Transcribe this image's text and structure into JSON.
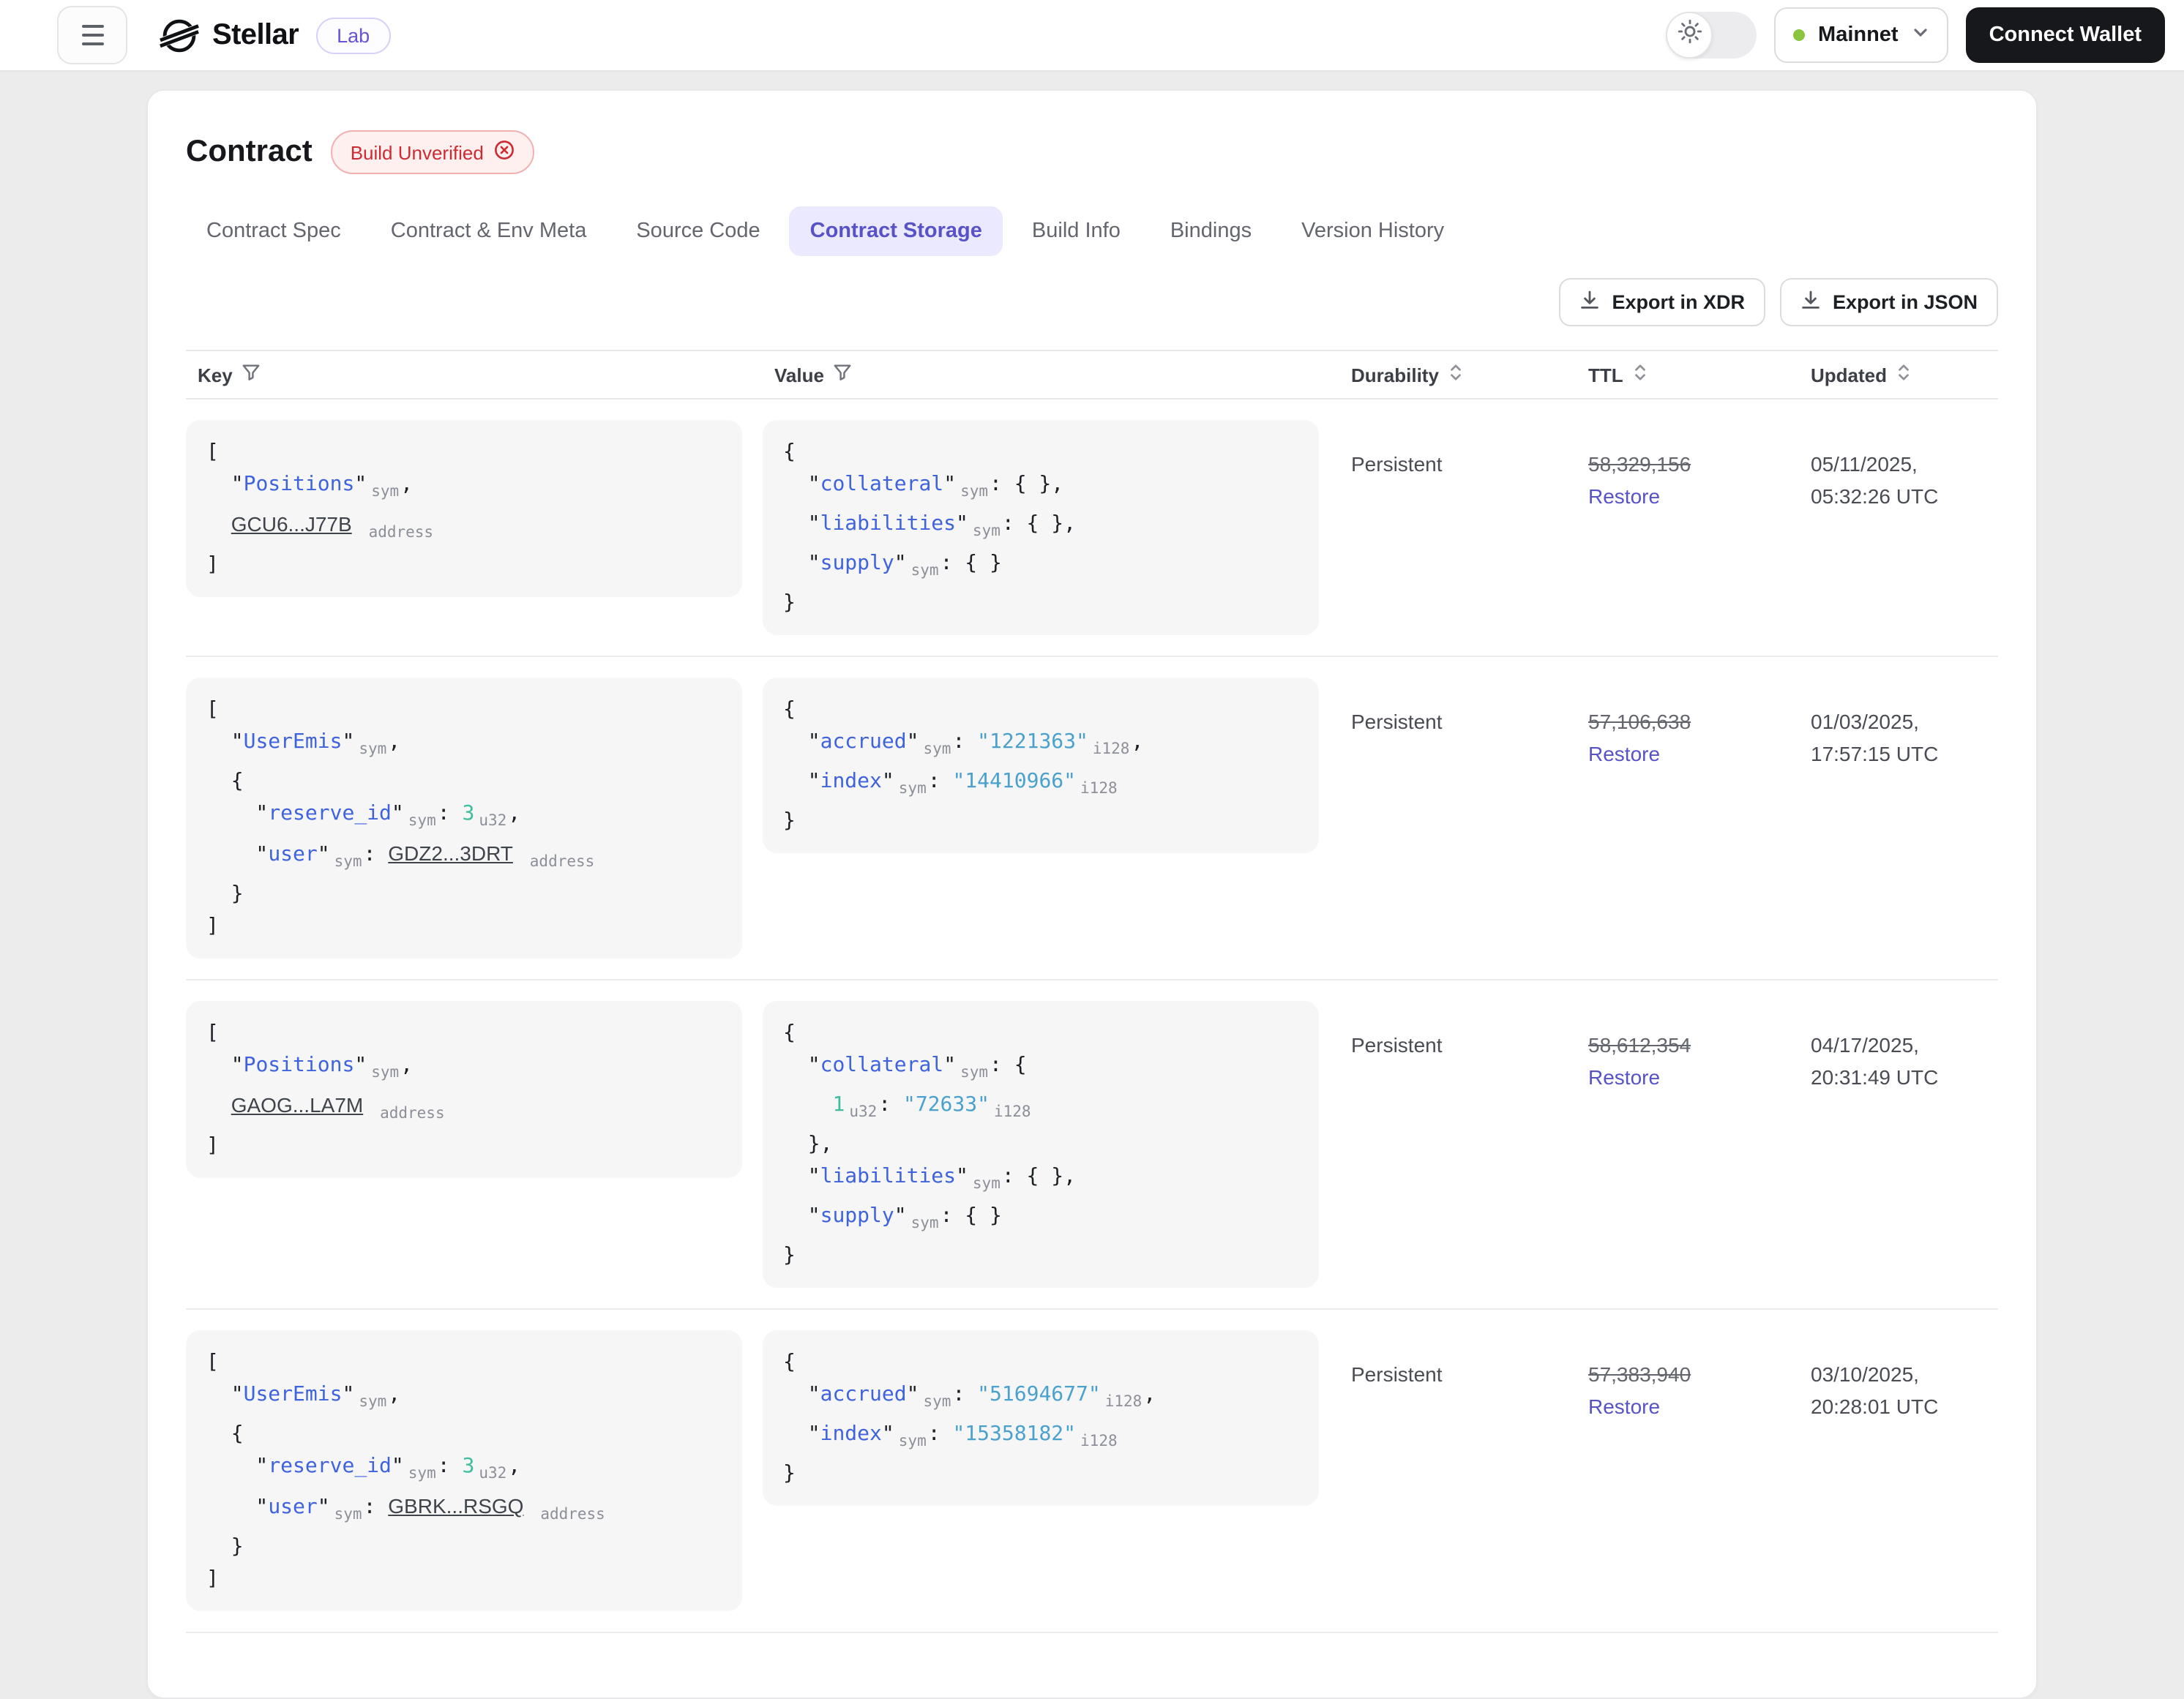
{
  "header": {
    "brand": "Stellar",
    "badge": "Lab",
    "network": "Mainnet",
    "connect_wallet": "Connect Wallet"
  },
  "page": {
    "title": "Contract",
    "status_badge": "Build Unverified",
    "tabs": [
      {
        "label": "Contract Spec"
      },
      {
        "label": "Contract & Env Meta"
      },
      {
        "label": "Source Code"
      },
      {
        "label": "Contract Storage",
        "active": true
      },
      {
        "label": "Build Info"
      },
      {
        "label": "Bindings"
      },
      {
        "label": "Version History"
      }
    ],
    "export_xdr": "Export in XDR",
    "export_json": "Export in JSON"
  },
  "table": {
    "columns": [
      "Key",
      "Value",
      "Durability",
      "TTL",
      "Updated"
    ],
    "rows": [
      {
        "key": [
          [
            {
              "t": "[",
              "c": "p"
            }
          ],
          [
            {
              "t": "  \"",
              "c": "p"
            },
            {
              "t": "Positions",
              "c": "k"
            },
            {
              "t": "\"",
              "c": "p"
            },
            {
              "t": "sym",
              "c": "l"
            },
            {
              "t": ",",
              "c": "p"
            }
          ],
          [
            {
              "t": "  ",
              "c": "p"
            },
            {
              "t": "GCU6...J77B",
              "c": "a"
            },
            {
              "t": " ",
              "c": "p"
            },
            {
              "t": "address",
              "c": "l"
            }
          ],
          [
            {
              "t": "]",
              "c": "p"
            }
          ]
        ],
        "value": [
          [
            {
              "t": "{",
              "c": "p"
            }
          ],
          [
            {
              "t": "  \"",
              "c": "p"
            },
            {
              "t": "collateral",
              "c": "k"
            },
            {
              "t": "\"",
              "c": "p"
            },
            {
              "t": "sym",
              "c": "l"
            },
            {
              "t": ": { },",
              "c": "p"
            }
          ],
          [
            {
              "t": "  \"",
              "c": "p"
            },
            {
              "t": "liabilities",
              "c": "k"
            },
            {
              "t": "\"",
              "c": "p"
            },
            {
              "t": "sym",
              "c": "l"
            },
            {
              "t": ": { },",
              "c": "p"
            }
          ],
          [
            {
              "t": "  \"",
              "c": "p"
            },
            {
              "t": "supply",
              "c": "k"
            },
            {
              "t": "\"",
              "c": "p"
            },
            {
              "t": "sym",
              "c": "l"
            },
            {
              "t": ": { }",
              "c": "p"
            }
          ],
          [
            {
              "t": "}",
              "c": "p"
            }
          ]
        ],
        "durability": "Persistent",
        "ttl": "58,329,156",
        "restore": "Restore",
        "updated": [
          "05/11/2025,",
          "05:32:26 UTC"
        ]
      },
      {
        "key": [
          [
            {
              "t": "[",
              "c": "p"
            }
          ],
          [
            {
              "t": "  \"",
              "c": "p"
            },
            {
              "t": "UserEmis",
              "c": "k"
            },
            {
              "t": "\"",
              "c": "p"
            },
            {
              "t": "sym",
              "c": "l"
            },
            {
              "t": ",",
              "c": "p"
            }
          ],
          [
            {
              "t": "  {",
              "c": "p"
            }
          ],
          [
            {
              "t": "    \"",
              "c": "p"
            },
            {
              "t": "reserve_id",
              "c": "k"
            },
            {
              "t": "\"",
              "c": "p"
            },
            {
              "t": "sym",
              "c": "l"
            },
            {
              "t": ": ",
              "c": "p"
            },
            {
              "t": "3",
              "c": "g"
            },
            {
              "t": "u32",
              "c": "l"
            },
            {
              "t": ",",
              "c": "p"
            }
          ],
          [
            {
              "t": "    \"",
              "c": "p"
            },
            {
              "t": "user",
              "c": "k"
            },
            {
              "t": "\"",
              "c": "p"
            },
            {
              "t": "sym",
              "c": "l"
            },
            {
              "t": ": ",
              "c": "p"
            },
            {
              "t": "GDZ2...3DRT",
              "c": "a"
            },
            {
              "t": " ",
              "c": "p"
            },
            {
              "t": "address",
              "c": "l"
            }
          ],
          [
            {
              "t": "  }",
              "c": "p"
            }
          ],
          [
            {
              "t": "]",
              "c": "p"
            }
          ]
        ],
        "value": [
          [
            {
              "t": "{",
              "c": "p"
            }
          ],
          [
            {
              "t": "  \"",
              "c": "p"
            },
            {
              "t": "accrued",
              "c": "k"
            },
            {
              "t": "\"",
              "c": "p"
            },
            {
              "t": "sym",
              "c": "l"
            },
            {
              "t": ": ",
              "c": "p"
            },
            {
              "t": "\"1221363\"",
              "c": "n"
            },
            {
              "t": "i128",
              "c": "l"
            },
            {
              "t": ",",
              "c": "p"
            }
          ],
          [
            {
              "t": "  \"",
              "c": "p"
            },
            {
              "t": "index",
              "c": "k"
            },
            {
              "t": "\"",
              "c": "p"
            },
            {
              "t": "sym",
              "c": "l"
            },
            {
              "t": ": ",
              "c": "p"
            },
            {
              "t": "\"14410966\"",
              "c": "n"
            },
            {
              "t": "i128",
              "c": "l"
            }
          ],
          [
            {
              "t": "}",
              "c": "p"
            }
          ]
        ],
        "durability": "Persistent",
        "ttl": "57,106,638",
        "restore": "Restore",
        "updated": [
          "01/03/2025,",
          "17:57:15 UTC"
        ]
      },
      {
        "key": [
          [
            {
              "t": "[",
              "c": "p"
            }
          ],
          [
            {
              "t": "  \"",
              "c": "p"
            },
            {
              "t": "Positions",
              "c": "k"
            },
            {
              "t": "\"",
              "c": "p"
            },
            {
              "t": "sym",
              "c": "l"
            },
            {
              "t": ",",
              "c": "p"
            }
          ],
          [
            {
              "t": "  ",
              "c": "p"
            },
            {
              "t": "GAOG...LA7M",
              "c": "a"
            },
            {
              "t": " ",
              "c": "p"
            },
            {
              "t": "address",
              "c": "l"
            }
          ],
          [
            {
              "t": "]",
              "c": "p"
            }
          ]
        ],
        "value": [
          [
            {
              "t": "{",
              "c": "p"
            }
          ],
          [
            {
              "t": "  \"",
              "c": "p"
            },
            {
              "t": "collateral",
              "c": "k"
            },
            {
              "t": "\"",
              "c": "p"
            },
            {
              "t": "sym",
              "c": "l"
            },
            {
              "t": ": {",
              "c": "p"
            }
          ],
          [
            {
              "t": "    ",
              "c": "p"
            },
            {
              "t": "1",
              "c": "g"
            },
            {
              "t": "u32",
              "c": "l"
            },
            {
              "t": ": ",
              "c": "p"
            },
            {
              "t": "\"72633\"",
              "c": "n"
            },
            {
              "t": "i128",
              "c": "l"
            }
          ],
          [
            {
              "t": "  },",
              "c": "p"
            }
          ],
          [
            {
              "t": "  \"",
              "c": "p"
            },
            {
              "t": "liabilities",
              "c": "k"
            },
            {
              "t": "\"",
              "c": "p"
            },
            {
              "t": "sym",
              "c": "l"
            },
            {
              "t": ": { },",
              "c": "p"
            }
          ],
          [
            {
              "t": "  \"",
              "c": "p"
            },
            {
              "t": "supply",
              "c": "k"
            },
            {
              "t": "\"",
              "c": "p"
            },
            {
              "t": "sym",
              "c": "l"
            },
            {
              "t": ": { }",
              "c": "p"
            }
          ],
          [
            {
              "t": "}",
              "c": "p"
            }
          ]
        ],
        "durability": "Persistent",
        "ttl": "58,612,354",
        "restore": "Restore",
        "updated": [
          "04/17/2025,",
          "20:31:49 UTC"
        ]
      },
      {
        "key": [
          [
            {
              "t": "[",
              "c": "p"
            }
          ],
          [
            {
              "t": "  \"",
              "c": "p"
            },
            {
              "t": "UserEmis",
              "c": "k"
            },
            {
              "t": "\"",
              "c": "p"
            },
            {
              "t": "sym",
              "c": "l"
            },
            {
              "t": ",",
              "c": "p"
            }
          ],
          [
            {
              "t": "  {",
              "c": "p"
            }
          ],
          [
            {
              "t": "    \"",
              "c": "p"
            },
            {
              "t": "reserve_id",
              "c": "k"
            },
            {
              "t": "\"",
              "c": "p"
            },
            {
              "t": "sym",
              "c": "l"
            },
            {
              "t": ": ",
              "c": "p"
            },
            {
              "t": "3",
              "c": "g"
            },
            {
              "t": "u32",
              "c": "l"
            },
            {
              "t": ",",
              "c": "p"
            }
          ],
          [
            {
              "t": "    \"",
              "c": "p"
            },
            {
              "t": "user",
              "c": "k"
            },
            {
              "t": "\"",
              "c": "p"
            },
            {
              "t": "sym",
              "c": "l"
            },
            {
              "t": ": ",
              "c": "p"
            },
            {
              "t": "GBRK...RSGQ",
              "c": "a"
            },
            {
              "t": " ",
              "c": "p"
            },
            {
              "t": "address",
              "c": "l"
            }
          ],
          [
            {
              "t": "  }",
              "c": "p"
            }
          ],
          [
            {
              "t": "]",
              "c": "p"
            }
          ]
        ],
        "value": [
          [
            {
              "t": "{",
              "c": "p"
            }
          ],
          [
            {
              "t": "  \"",
              "c": "p"
            },
            {
              "t": "accrued",
              "c": "k"
            },
            {
              "t": "\"",
              "c": "p"
            },
            {
              "t": "sym",
              "c": "l"
            },
            {
              "t": ": ",
              "c": "p"
            },
            {
              "t": "\"51694677\"",
              "c": "n"
            },
            {
              "t": "i128",
              "c": "l"
            },
            {
              "t": ",",
              "c": "p"
            }
          ],
          [
            {
              "t": "  \"",
              "c": "p"
            },
            {
              "t": "index",
              "c": "k"
            },
            {
              "t": "\"",
              "c": "p"
            },
            {
              "t": "sym",
              "c": "l"
            },
            {
              "t": ": ",
              "c": "p"
            },
            {
              "t": "\"15358182\"",
              "c": "n"
            },
            {
              "t": "i128",
              "c": "l"
            }
          ],
          [
            {
              "t": "}",
              "c": "p"
            }
          ]
        ],
        "durability": "Persistent",
        "ttl": "57,383,940",
        "restore": "Restore",
        "updated": [
          "03/10/2025,",
          "20:28:01 UTC"
        ]
      }
    ]
  },
  "icons": {
    "menu-icon": "hamburger (3 bars)",
    "stellar-logo-icon": "circle with double diagonal slash",
    "sun-icon": "outline sun",
    "chevron-down-icon": "v",
    "x-circle-icon": "x in circle",
    "download-icon": "arrow down into tray",
    "filter-icon": "funnel",
    "sort-icon": "up/down chevrons",
    "network-status-dot": "green dot"
  },
  "colors": {
    "accent": "#5753C6",
    "accent_bg": "#EBE9FD",
    "code_key": "#3E63DD",
    "code_string": "#4BA1CD",
    "code_number": "#40BD9D",
    "code_label": "#8D8F98",
    "danger_text": "#CD2B31",
    "danger_bg": "#FFF0F0",
    "danger_border": "#F3B0B2",
    "network_dot": "#8BC53F",
    "button_dark": "#17181C",
    "page_bg": "#ECECEC"
  }
}
